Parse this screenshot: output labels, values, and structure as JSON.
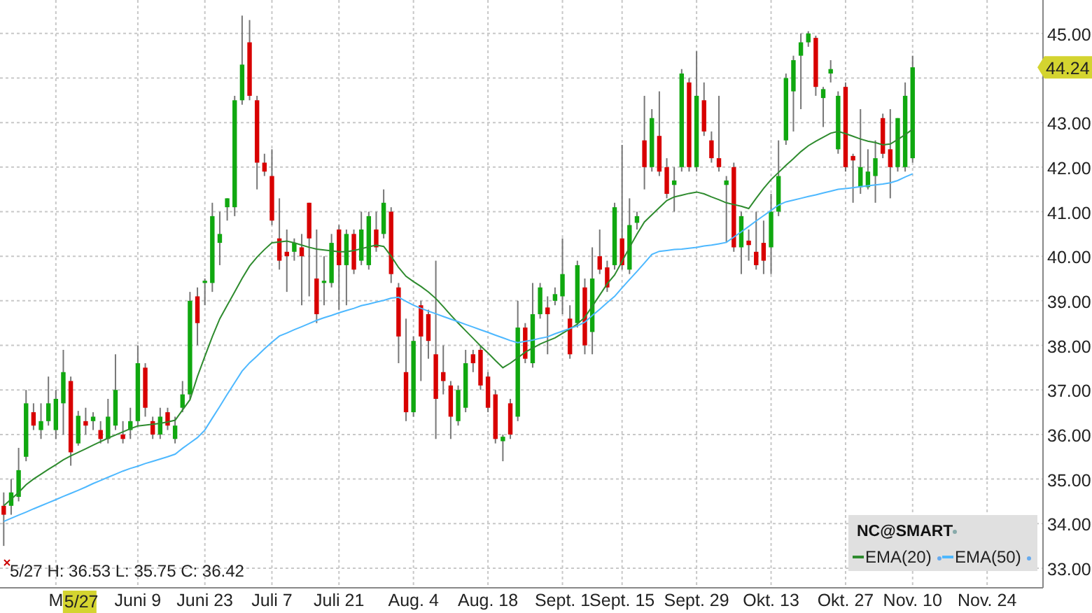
{
  "chart": {
    "chart_data": {
      "type": "candlestick",
      "categories": [
        null,
        null,
        null,
        null,
        null,
        null,
        null,
        "M",
        null,
        null,
        null,
        null,
        null,
        null,
        null,
        null,
        null,
        null,
        "Juni 9",
        null,
        null,
        null,
        null,
        null,
        null,
        null,
        null,
        "Juni 23",
        null,
        null,
        null,
        null,
        null,
        null,
        null,
        null,
        "Juli 7",
        null,
        null,
        null,
        null,
        null,
        null,
        null,
        null,
        "Juli 21",
        null,
        null,
        null,
        null,
        null,
        null,
        null,
        null,
        null,
        "Aug. 4",
        null,
        null,
        null,
        null,
        null,
        null,
        null,
        null,
        null,
        "Aug. 18",
        null,
        null,
        null,
        null,
        null,
        null,
        null,
        null,
        null,
        "Sept. 1",
        null,
        null,
        null,
        null,
        null,
        null,
        null,
        "Sept. 15",
        null,
        null,
        null,
        null,
        null,
        null,
        null,
        null,
        null,
        "Sept. 29",
        null,
        null,
        null,
        null,
        null,
        null,
        null,
        null,
        null,
        "Okt. 13",
        null,
        null,
        null,
        null,
        null,
        null,
        null,
        null,
        null,
        "Okt. 27",
        null,
        null,
        null,
        null,
        null,
        null,
        null,
        null,
        "Nov. 10",
        null,
        null,
        null,
        null,
        null,
        null,
        null,
        null,
        null,
        "Nov. 24",
        null,
        null,
        null,
        null,
        null,
        null,
        null
      ],
      "ylim": [
        32.56,
        45.75
      ],
      "grid": true,
      "legend": "lower right",
      "yticks": [
        {
          "value": 33,
          "label": "33.00"
        },
        {
          "value": 34,
          "label": "34.00"
        },
        {
          "value": 35,
          "label": "35.00"
        },
        {
          "value": 36,
          "label": "36.00"
        },
        {
          "value": 37,
          "label": "37.00"
        },
        {
          "value": 38,
          "label": "38.00"
        },
        {
          "value": 39,
          "label": "39.00"
        },
        {
          "value": 40,
          "label": "40.00"
        },
        {
          "value": 41,
          "label": "41.00"
        },
        {
          "value": 42,
          "label": "42.00"
        },
        {
          "value": 43,
          "label": "43.00"
        },
        {
          "value": 45,
          "label": "45.00"
        }
      ],
      "ohlc": [
        [
          34.4,
          34.7,
          33.5,
          34.2
        ],
        [
          34.4,
          35.0,
          34.2,
          34.7
        ],
        [
          34.6,
          35.7,
          34.5,
          35.2
        ],
        [
          35.5,
          37.0,
          35.4,
          36.7
        ],
        [
          36.5,
          36.7,
          36.1,
          36.2
        ],
        [
          36.1,
          36.7,
          35.9,
          36.3
        ],
        [
          36.3,
          37.3,
          36.2,
          36.7
        ],
        [
          36.1,
          37.0,
          35.9,
          36.8
        ],
        [
          36.7,
          37.9,
          36.0,
          37.4
        ],
        [
          37.2,
          37.3,
          35.3,
          35.6
        ],
        [
          35.8,
          36.53,
          35.75,
          36.42
        ],
        [
          36.3,
          36.6,
          36.0,
          36.2
        ],
        [
          36.3,
          36.5,
          36.1,
          36.4
        ],
        [
          36.1,
          36.3,
          35.8,
          35.9
        ],
        [
          35.9,
          36.8,
          35.8,
          36.4
        ],
        [
          36.2,
          37.8,
          36.1,
          37.0
        ],
        [
          36.0,
          36.3,
          35.8,
          35.9
        ],
        [
          36.1,
          36.6,
          35.9,
          36.3
        ],
        [
          36.3,
          38.0,
          36.2,
          37.6
        ],
        [
          37.5,
          37.6,
          36.4,
          36.6
        ],
        [
          36.3,
          36.4,
          35.9,
          36.0
        ],
        [
          36.0,
          36.6,
          35.9,
          36.4
        ],
        [
          36.5,
          36.6,
          36.1,
          36.2
        ],
        [
          35.9,
          36.4,
          35.8,
          36.2
        ],
        [
          36.6,
          37.2,
          36.5,
          36.9
        ],
        [
          36.9,
          39.2,
          36.8,
          39.0
        ],
        [
          39.1,
          39.3,
          38.0,
          38.5
        ],
        [
          39.4,
          39.5,
          38.9,
          39.45
        ],
        [
          39.4,
          41.2,
          39.2,
          40.9
        ],
        [
          40.3,
          41.0,
          39.8,
          40.5
        ],
        [
          41.1,
          41.3,
          40.8,
          41.3
        ],
        [
          41.1,
          43.6,
          40.9,
          43.5
        ],
        [
          43.5,
          45.4,
          43.4,
          44.3
        ],
        [
          44.8,
          45.3,
          43.5,
          43.6
        ],
        [
          43.5,
          43.6,
          41.5,
          42.1
        ],
        [
          42.1,
          42.3,
          41.8,
          41.9
        ],
        [
          41.8,
          42.4,
          40.7,
          40.8
        ],
        [
          40.4,
          41.3,
          39.7,
          39.9
        ],
        [
          40.1,
          40.6,
          39.2,
          40.0
        ],
        [
          40.1,
          40.4,
          39.9,
          40.3
        ],
        [
          40.2,
          40.5,
          38.9,
          40.0
        ],
        [
          41.2,
          41.2,
          39.1,
          40.4
        ],
        [
          39.5,
          40.6,
          38.5,
          38.7
        ],
        [
          39.4,
          40.0,
          38.9,
          39.45
        ],
        [
          39.4,
          40.5,
          39.3,
          40.3
        ],
        [
          40.6,
          40.7,
          38.8,
          39.8
        ],
        [
          39.8,
          40.6,
          38.9,
          40.5
        ],
        [
          40.5,
          40.6,
          39.6,
          39.7
        ],
        [
          39.9,
          41.0,
          39.8,
          40.6
        ],
        [
          39.8,
          41.0,
          39.7,
          40.9
        ],
        [
          40.6,
          41.0,
          40.1,
          40.2
        ],
        [
          40.5,
          41.5,
          40.4,
          41.2
        ],
        [
          41.0,
          41.1,
          39.4,
          39.6
        ],
        [
          39.3,
          39.4,
          37.6,
          38.2
        ],
        [
          37.4,
          38.6,
          36.3,
          36.5
        ],
        [
          36.5,
          38.2,
          36.4,
          38.1
        ],
        [
          38.9,
          39.0,
          37.2,
          38.2
        ],
        [
          38.7,
          38.8,
          37.7,
          38.1
        ],
        [
          37.8,
          39.9,
          35.9,
          36.8
        ],
        [
          37.4,
          38.0,
          36.9,
          37.2
        ],
        [
          37.1,
          37.2,
          35.9,
          36.4
        ],
        [
          36.3,
          37.1,
          36.2,
          37.0
        ],
        [
          36.6,
          37.9,
          36.5,
          37.6
        ],
        [
          37.8,
          37.9,
          37.4,
          37.6
        ],
        [
          37.9,
          38.0,
          37.0,
          37.1
        ],
        [
          37.3,
          37.4,
          36.5,
          36.6
        ],
        [
          36.9,
          37.0,
          35.8,
          35.9
        ],
        [
          35.85,
          36.0,
          35.4,
          35.95
        ],
        [
          36.7,
          36.8,
          35.9,
          36.0
        ],
        [
          36.4,
          39.0,
          36.3,
          38.4
        ],
        [
          38.4,
          38.5,
          37.6,
          37.7
        ],
        [
          37.6,
          39.4,
          37.5,
          38.7
        ],
        [
          38.7,
          39.4,
          38.6,
          39.3
        ],
        [
          38.85,
          39.1,
          37.8,
          38.7
        ],
        [
          39.0,
          39.3,
          38.9,
          39.15
        ],
        [
          39.1,
          40.4,
          38.7,
          39.6
        ],
        [
          38.6,
          38.9,
          37.7,
          37.8
        ],
        [
          38.5,
          39.9,
          38.4,
          39.8
        ],
        [
          39.3,
          39.5,
          37.8,
          38.0
        ],
        [
          38.3,
          40.2,
          37.8,
          39.5
        ],
        [
          40.0,
          40.6,
          39.6,
          39.7
        ],
        [
          39.75,
          39.9,
          39.2,
          39.3
        ],
        [
          39.8,
          41.2,
          39.7,
          41.1
        ],
        [
          40.4,
          42.5,
          39.7,
          39.8
        ],
        [
          39.7,
          41.3,
          39.6,
          40.7
        ],
        [
          40.75,
          41.0,
          40.6,
          40.9
        ],
        [
          42.6,
          43.6,
          41.5,
          42.0
        ],
        [
          42.0,
          43.3,
          41.9,
          43.1
        ],
        [
          42.7,
          43.7,
          41.8,
          41.9
        ],
        [
          42.0,
          42.2,
          41.3,
          41.4
        ],
        [
          41.6,
          42.0,
          41.0,
          41.7
        ],
        [
          42.0,
          44.2,
          41.9,
          44.1
        ],
        [
          43.9,
          44.0,
          41.9,
          42.0
        ],
        [
          42.0,
          44.6,
          41.9,
          43.6
        ],
        [
          43.5,
          43.9,
          42.7,
          42.8
        ],
        [
          42.6,
          42.8,
          42.1,
          42.2
        ],
        [
          42.2,
          43.6,
          41.9,
          42.0
        ],
        [
          41.6,
          41.8,
          40.3,
          41.7
        ],
        [
          42.0,
          42.1,
          40.1,
          40.2
        ],
        [
          40.2,
          41.0,
          39.6,
          40.9
        ],
        [
          40.35,
          40.6,
          39.9,
          40.25
        ],
        [
          40.1,
          41.0,
          39.7,
          39.8
        ],
        [
          40.3,
          40.8,
          39.6,
          39.9
        ],
        [
          40.2,
          41.4,
          39.6,
          41.0
        ],
        [
          41.0,
          42.6,
          40.9,
          41.8
        ],
        [
          42.6,
          44.1,
          42.5,
          44.0
        ],
        [
          43.7,
          44.5,
          42.8,
          44.4
        ],
        [
          44.5,
          45.0,
          43.3,
          44.8
        ],
        [
          44.8,
          45.05,
          44.7,
          45.0
        ],
        [
          44.9,
          44.95,
          43.6,
          43.8
        ],
        [
          43.55,
          43.8,
          42.9,
          43.75
        ],
        [
          44.1,
          44.4,
          43.9,
          44.2
        ],
        [
          42.4,
          43.7,
          42.3,
          43.6
        ],
        [
          43.8,
          43.9,
          41.9,
          42.0
        ],
        [
          42.25,
          42.3,
          41.2,
          42.15
        ],
        [
          41.55,
          43.3,
          41.4,
          42.0
        ],
        [
          41.55,
          42.4,
          41.5,
          41.9
        ],
        [
          41.8,
          42.6,
          41.2,
          42.2
        ],
        [
          43.1,
          43.2,
          42.2,
          42.3
        ],
        [
          42.4,
          43.3,
          41.3,
          42.0
        ],
        [
          42.0,
          43.1,
          41.9,
          43.1
        ],
        [
          42.0,
          43.9,
          41.9,
          43.6
        ],
        [
          42.2,
          44.5,
          42.1,
          44.24
        ],
        null,
        null,
        null,
        null,
        null,
        null,
        null,
        null,
        null,
        null,
        null,
        null,
        null,
        null,
        null,
        null,
        null
      ],
      "series": [
        {
          "name": "EMA(20)",
          "type": "line",
          "color": "#2e8b2e",
          "values": [
            34.4,
            34.55,
            34.7,
            34.87,
            35.0,
            35.11,
            35.22,
            35.32,
            35.43,
            35.52,
            35.6,
            35.68,
            35.76,
            35.84,
            35.92,
            35.99,
            36.06,
            36.13,
            36.19,
            36.21,
            36.23,
            36.25,
            36.28,
            36.32,
            36.55,
            36.78,
            37.3,
            37.75,
            38.2,
            38.6,
            38.9,
            39.2,
            39.5,
            39.78,
            39.98,
            40.15,
            40.3,
            40.32,
            40.34,
            40.3,
            40.25,
            40.2,
            40.16,
            40.14,
            40.12,
            40.1,
            40.1,
            40.13,
            40.17,
            40.21,
            40.25,
            40.22,
            40.0,
            39.75,
            39.55,
            39.43,
            39.32,
            39.2,
            39.05,
            38.87,
            38.68,
            38.5,
            38.33,
            38.16,
            37.99,
            37.83,
            37.66,
            37.5,
            37.6,
            37.72,
            37.85,
            37.94,
            38.03,
            38.1,
            38.17,
            38.27,
            38.37,
            38.48,
            38.63,
            38.88,
            39.13,
            39.38,
            39.58,
            39.88,
            40.2,
            40.5,
            40.77,
            40.93,
            41.09,
            41.25,
            41.33,
            41.37,
            41.41,
            41.44,
            41.4,
            41.33,
            41.27,
            41.2,
            41.16,
            41.12,
            41.07,
            41.3,
            41.52,
            41.72,
            41.88,
            42.04,
            42.19,
            42.35,
            42.48,
            42.58,
            42.67,
            42.76,
            42.8,
            42.75,
            42.69,
            42.63,
            42.58,
            42.55,
            42.5,
            42.52,
            42.62,
            42.73,
            42.85,
            null,
            null,
            null,
            null,
            null,
            null,
            null,
            null,
            null,
            null,
            null,
            null,
            null,
            null,
            null,
            null,
            null
          ]
        },
        {
          "name": "EMA(50)",
          "type": "line",
          "color": "#4db8ff",
          "values": [
            34.05,
            34.12,
            34.19,
            34.26,
            34.33,
            34.4,
            34.47,
            34.54,
            34.61,
            34.68,
            34.75,
            34.82,
            34.9,
            34.97,
            35.04,
            35.11,
            35.18,
            35.24,
            35.29,
            35.35,
            35.4,
            35.45,
            35.5,
            35.56,
            35.69,
            35.81,
            35.93,
            36.1,
            36.37,
            36.63,
            36.9,
            37.16,
            37.42,
            37.61,
            37.76,
            37.92,
            38.07,
            38.21,
            38.28,
            38.35,
            38.42,
            38.49,
            38.56,
            38.62,
            38.67,
            38.73,
            38.78,
            38.83,
            38.89,
            38.93,
            38.97,
            39.01,
            39.06,
            39.08,
            38.99,
            38.9,
            38.83,
            38.77,
            38.71,
            38.65,
            38.59,
            38.53,
            38.47,
            38.41,
            38.35,
            38.29,
            38.23,
            38.17,
            38.11,
            38.06,
            38.09,
            38.12,
            38.16,
            38.19,
            38.26,
            38.32,
            38.38,
            38.44,
            38.52,
            38.67,
            38.81,
            38.96,
            39.1,
            39.29,
            39.48,
            39.66,
            39.85,
            40.04,
            40.11,
            40.13,
            40.15,
            40.16,
            40.18,
            40.2,
            40.23,
            40.25,
            40.28,
            40.31,
            40.43,
            40.55,
            40.67,
            40.79,
            40.91,
            41.03,
            41.15,
            41.22,
            41.26,
            41.3,
            41.34,
            41.38,
            41.42,
            41.46,
            41.5,
            41.52,
            41.54,
            41.56,
            41.58,
            41.6,
            41.62,
            41.65,
            41.7,
            41.78,
            41.85,
            null,
            null,
            null,
            null,
            null,
            null,
            null,
            null,
            null,
            null,
            null,
            null,
            null,
            null,
            null,
            null,
            null
          ]
        }
      ]
    },
    "last_price": "44.24",
    "crosshair": {
      "date": "5/27",
      "readout": "5/27 H: 36.53 L: 35.75 C: 36.42"
    },
    "legend": {
      "title": "NC@SMART"
    }
  }
}
